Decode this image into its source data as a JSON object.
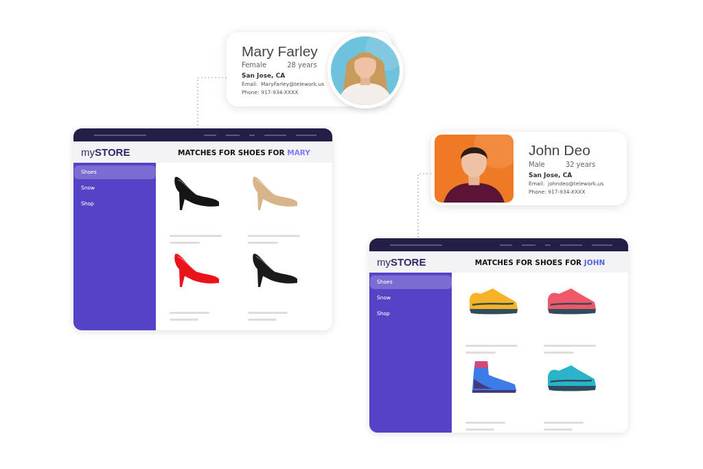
{
  "profiles": [
    {
      "name": "Mary Farley",
      "gender": "Female",
      "age": "28 years",
      "location": "San Jose, CA",
      "email": "Email:  MaryFarley@telework.us",
      "phone": "Phone: 917-934-XXXX",
      "kind": "round"
    },
    {
      "name": "John Deo",
      "gender": "Male",
      "age": "32 years",
      "location": "San Jose, CA",
      "email": "Email:  johndeo@telework.us",
      "phone": "Phone: 917-934-XXXX",
      "kind": "square"
    }
  ],
  "stores": [
    {
      "logo": "my**STORE**",
      "heading": "MATCHES FOR SHOES FOR",
      "heading_name": "MARY",
      "sidebar": {
        "items": [
          {
            "label": "Shoes",
            "selected": true
          },
          {
            "label": "Snow",
            "selected": false
          },
          {
            "label": "Shop",
            "selected": false
          }
        ]
      },
      "products": [
        {
          "kind": "heel",
          "color": "#151515"
        },
        {
          "kind": "heel",
          "color": "#d8b48a"
        },
        {
          "kind": "heel",
          "color": "#e8141a"
        },
        {
          "kind": "heel",
          "color": "#1a1a1a"
        }
      ]
    },
    {
      "logo": "my**STORE**",
      "heading": "MATCHES FOR SHOES FOR",
      "heading_name": "JOHN",
      "sidebar": {
        "items": [
          {
            "label": "Shoes",
            "selected": true
          },
          {
            "label": "Snow",
            "selected": false
          },
          {
            "label": "Shop",
            "selected": false
          }
        ]
      },
      "products": [
        {
          "kind": "sneaker",
          "color": "#f5b325"
        },
        {
          "kind": "sneaker",
          "color": "#f0586a"
        },
        {
          "kind": "boot",
          "color": "#3d7be8"
        },
        {
          "kind": "sneaker",
          "color": "#2bb3c9"
        }
      ]
    }
  ]
}
